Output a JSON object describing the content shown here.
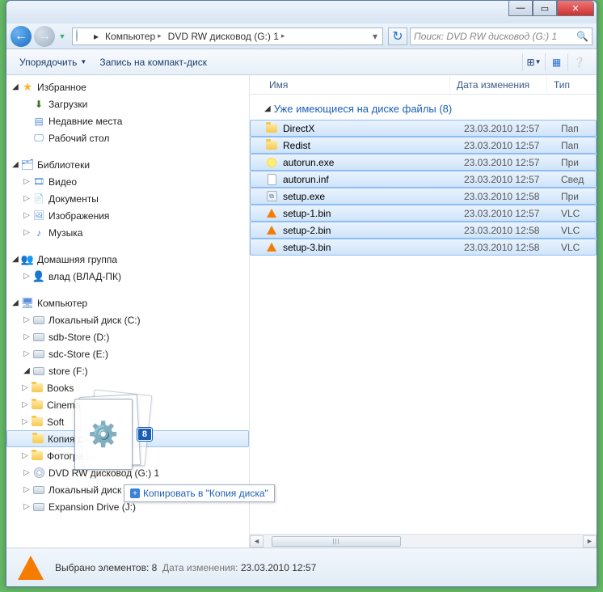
{
  "titlebar": {
    "min": "—",
    "max": "▭",
    "close": "✕"
  },
  "nav": {
    "back": "←",
    "fwd": "→"
  },
  "address": {
    "segments": [
      "Компьютер",
      "DVD RW дисковод (G:) 1"
    ]
  },
  "search": {
    "placeholder": "Поиск: DVD RW дисковод (G:) 1"
  },
  "toolbar": {
    "organize": "Упорядочить",
    "burn": "Запись на компакт-диск"
  },
  "sidebar": {
    "favorites": {
      "label": "Избранное",
      "items": [
        "Загрузки",
        "Недавние места",
        "Рабочий стол"
      ]
    },
    "libraries": {
      "label": "Библиотеки",
      "items": [
        "Видео",
        "Документы",
        "Изображения",
        "Музыка"
      ]
    },
    "homegroup": {
      "label": "Домашняя группа",
      "items": [
        "влад (ВЛАД-ПК)"
      ]
    },
    "computer": {
      "label": "Компьютер",
      "drives": [
        "Локальный диск (C:)",
        "sdb-Store (D:)",
        "sdc-Store (E:)"
      ],
      "store": {
        "label": "store (F:)",
        "folders": [
          "Books",
          "Cinema",
          "Soft",
          "Копия диска",
          "Фотографии"
        ]
      },
      "more": [
        "DVD RW дисковод (G:) 1",
        "Локальный диск (I:)",
        "Expansion Drive (J:)"
      ]
    }
  },
  "columns": {
    "name": "Имя",
    "date": "Дата изменения",
    "type": "Тип"
  },
  "group": {
    "label": "Уже имеющиеся на диске файлы (8)"
  },
  "files": [
    {
      "name": "DirectX",
      "date": "23.03.2010 12:57",
      "type": "Пап",
      "icon": "folder"
    },
    {
      "name": "Redist",
      "date": "23.03.2010 12:57",
      "type": "Пап",
      "icon": "folder"
    },
    {
      "name": "autorun.exe",
      "date": "23.03.2010 12:57",
      "type": "При",
      "icon": "autorun"
    },
    {
      "name": "autorun.inf",
      "date": "23.03.2010 12:57",
      "type": "Свед",
      "icon": "file"
    },
    {
      "name": "setup.exe",
      "date": "23.03.2010 12:58",
      "type": "При",
      "icon": "exe"
    },
    {
      "name": "setup-1.bin",
      "date": "23.03.2010 12:57",
      "type": "VLC",
      "icon": "vlc"
    },
    {
      "name": "setup-2.bin",
      "date": "23.03.2010 12:58",
      "type": "VLC",
      "icon": "vlc"
    },
    {
      "name": "setup-3.bin",
      "date": "23.03.2010 12:58",
      "type": "VLC",
      "icon": "vlc"
    }
  ],
  "drag": {
    "count": "8",
    "tooltip": "Копировать в \"Копия диска\""
  },
  "status": {
    "selected_label": "Выбрано элементов: 8",
    "date_label": "Дата изменения:",
    "date_value": "23.03.2010 12:57"
  }
}
